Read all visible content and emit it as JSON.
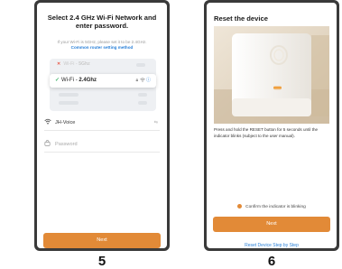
{
  "left_screen": {
    "title": "Select 2.4 GHz Wi-Fi Network and enter password.",
    "subtitle": "If your Wi-Fi is 5GHz, please set it to be 2.4GHz.",
    "router_link": "Common router setting method",
    "wifi_5g_prefix": "Wi-Fi - ",
    "wifi_5g_band": "5Ghz",
    "wifi_24_prefix": "Wi-Fi - ",
    "wifi_24_band": "2.4Ghz",
    "ssid_value": "JH-Voice",
    "password_placeholder": "Password",
    "next_label": "Next",
    "step_number": "5"
  },
  "right_screen": {
    "title": "Reset the device",
    "description": "Press and hold the RESET button for 5 seconds until the indicator blinks (subject to the user manual).",
    "confirm_label": "Confirm the indicator is blinking",
    "next_label": "Next",
    "reset_link": "Reset Device Step by Step",
    "step_number": "6"
  },
  "colors": {
    "accent": "#e28a37",
    "link": "#2a80d8",
    "check": "#3fb36b",
    "cross": "#e85b4a"
  }
}
